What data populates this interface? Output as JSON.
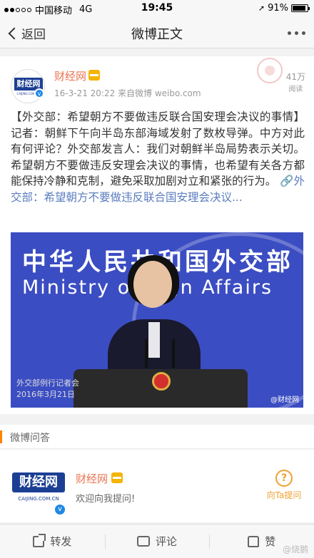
{
  "status_bar": {
    "carrier": "中国移动",
    "network": "4G",
    "time": "19:45",
    "battery": "91%",
    "battery_level": 0.91
  },
  "nav": {
    "back_label": "返回",
    "title": "微博正文"
  },
  "post": {
    "user_name": "财经网",
    "avatar_text": "财经网",
    "avatar_domain": "CAIJING.COM.CN",
    "time_source": "16-3-21 20:22  来自微博 weibo.com",
    "reads_count": "41万",
    "reads_label": "阅读",
    "text": "【外交部：希望朝方不要做违反联合国安理会决议的事情】记者：朝鲜下午向半岛东部海域发射了数枚导弹。中方对此有何评论？外交部发言人：我们对朝鲜半岛局势表示关切。希望朝方不要做违反安理会决议的事情，也希望有关各方都能保持冷静和克制，避免采取加剧对立和紧张的行为。",
    "link_text": "🔗外交部：希望朝方不要做违反联合国安理会决议...",
    "image": {
      "sign_cn": "中华人民共和国外交部",
      "sign_en": "Ministry of F   gn Affairs",
      "caption_1": "外交部例行记者会",
      "caption_2": "2016年3月21日",
      "watermark": "@财经网"
    }
  },
  "qa": {
    "section_title": "微博问答",
    "user_name": "财经网",
    "avatar_text": "财经网",
    "avatar_domain": "CAIJING.COM.CN",
    "welcome": "欢迎向我提问!",
    "ask_label": "向Ta提问"
  },
  "actions": {
    "repost": "转发",
    "comment": "评论",
    "like": "赞"
  },
  "watermark": "@烧鹅"
}
